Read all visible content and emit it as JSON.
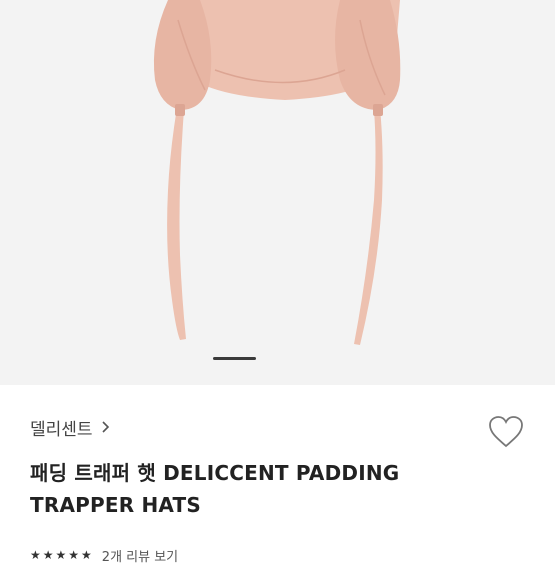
{
  "product": {
    "brand": "델리센트",
    "title": "패딩 트래퍼 햇 DELICCENT PADDING TRAPPER HATS",
    "rating_stars": "★★★★★",
    "review_link": "2개 리뷰 보기"
  },
  "colors": {
    "hat": "#edc1b0",
    "hat_shade": "#dca593",
    "background": "#f3f3f3",
    "indicator": "#3a3a3a"
  },
  "icons": [
    "chevron-right-icon",
    "heart-icon"
  ]
}
